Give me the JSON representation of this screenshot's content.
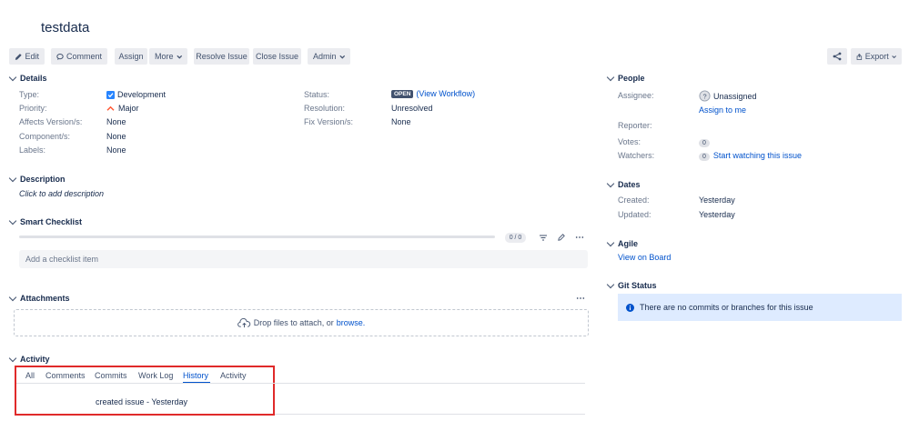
{
  "issue": {
    "title": "testdata"
  },
  "toolbar": {
    "edit": "Edit",
    "comment": "Comment",
    "assign": "Assign",
    "more": "More",
    "resolve": "Resolve Issue",
    "close": "Close Issue",
    "admin": "Admin",
    "export": "Export"
  },
  "details": {
    "heading": "Details",
    "type_label": "Type:",
    "type_value": "Development",
    "priority_label": "Priority:",
    "priority_value": "Major",
    "affects_label": "Affects Version/s:",
    "affects_value": "None",
    "component_label": "Component/s:",
    "component_value": "None",
    "labels_label": "Labels:",
    "labels_value": "None",
    "status_label": "Status:",
    "status_badge": "OPEN",
    "status_link": "(View Workflow)",
    "resolution_label": "Resolution:",
    "resolution_value": "Unresolved",
    "fix_label": "Fix Version/s:",
    "fix_value": "None"
  },
  "description": {
    "heading": "Description",
    "placeholder": "Click to add description"
  },
  "checklist": {
    "heading": "Smart Checklist",
    "progress": "0 / 0",
    "placeholder": "Add a checklist item"
  },
  "attachments": {
    "heading": "Attachments",
    "drop_text": "Drop files to attach, or",
    "browse_link": "browse."
  },
  "activity": {
    "heading": "Activity",
    "tabs": [
      "All",
      "Comments",
      "Commits",
      "Work Log",
      "History",
      "Activity"
    ],
    "active_tab": "History",
    "entry": "created issue - Yesterday"
  },
  "people": {
    "heading": "People",
    "assignee_label": "Assignee:",
    "assignee_value": "Unassigned",
    "assign_me_link": "Assign to me",
    "reporter_label": "Reporter:",
    "votes_label": "Votes:",
    "votes_count": "0",
    "watchers_label": "Watchers:",
    "watchers_count": "0",
    "watch_link": "Start watching this issue"
  },
  "dates": {
    "heading": "Dates",
    "created_label": "Created:",
    "created_value": "Yesterday",
    "updated_label": "Updated:",
    "updated_value": "Yesterday"
  },
  "agile": {
    "heading": "Agile",
    "board_link": "View on Board"
  },
  "git": {
    "heading": "Git Status",
    "message": "There are no commits or branches for this issue"
  },
  "colors": {
    "link": "#0052cc",
    "highlight_box": "#e02a2a",
    "info_bg": "#deebff",
    "type_blue": "#2684ff",
    "priority_red": "#ff5630"
  }
}
